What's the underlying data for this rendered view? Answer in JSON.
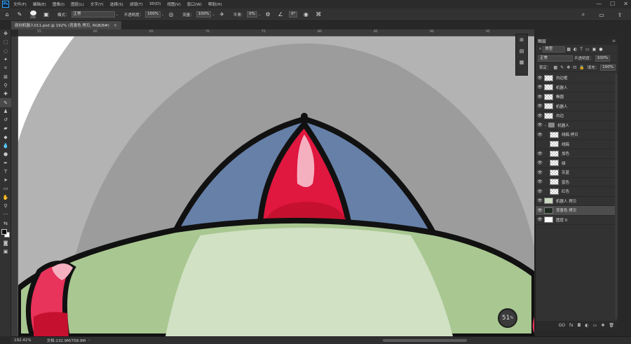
{
  "app": {
    "logo": "Ps",
    "menu": [
      "文件(F)",
      "编辑(E)",
      "图像(I)",
      "图层(L)",
      "文字(Y)",
      "选择(S)",
      "滤镜(T)",
      "3D(D)",
      "视图(V)",
      "窗口(W)",
      "帮助(H)"
    ],
    "window_controls": [
      "—",
      "☐",
      "✕"
    ]
  },
  "options_bar": {
    "brush_size": "256",
    "mode_label": "模式：",
    "mode_value": "正常",
    "opacity_label": "不透明度：",
    "opacity_value": "100%",
    "flow_label": "流量：",
    "flow_value": "100%",
    "smoothing_label": "平滑：",
    "smoothing_value": "0%",
    "angle_value": "0°"
  },
  "document": {
    "tab_title": "原创机器人011.psd @ 192% (背景色 拷贝, RGB/8#)",
    "close": "×"
  },
  "rulers": {
    "top": [
      "55",
      "60",
      "65",
      "70",
      "75",
      "80",
      "85",
      "90",
      "95"
    ]
  },
  "status": {
    "zoom": "192.41%",
    "doc_info": "文档:132.9M/758.9M",
    "arrow": "›"
  },
  "zoom_hud": {
    "value": "51",
    "unit": "%"
  },
  "layers_panel": {
    "title": "图层",
    "close": "≡",
    "filter_kind": "类型",
    "blend_mode": "正常",
    "opacity_label": "不透明度：",
    "opacity_value": "100%",
    "lock_label": "锁定：",
    "fill_label": "填充：",
    "fill_value": "100%",
    "layers": [
      {
        "name": "白边框",
        "visible": true,
        "indent": false
      },
      {
        "name": "机器人",
        "visible": true,
        "indent": false
      },
      {
        "name": "椭圆",
        "visible": true,
        "indent": false
      },
      {
        "name": "机器人",
        "visible": true,
        "indent": false
      },
      {
        "name": "白边",
        "visible": true,
        "indent": false
      },
      {
        "name": "机器人",
        "visible": true,
        "indent": false,
        "group": true
      },
      {
        "name": "线稿 拷贝",
        "visible": true,
        "indent": true
      },
      {
        "name": "线稿",
        "visible": false,
        "indent": true
      },
      {
        "name": "加色",
        "visible": true,
        "indent": true
      },
      {
        "name": "绿",
        "visible": true,
        "indent": true
      },
      {
        "name": "灰蓝",
        "visible": true,
        "indent": true
      },
      {
        "name": "蓝色",
        "visible": true,
        "indent": true
      },
      {
        "name": "红色",
        "visible": true,
        "indent": true
      },
      {
        "name": "机器人 拷贝",
        "visible": true,
        "indent": false
      },
      {
        "name": "背景色 拷贝",
        "visible": true,
        "indent": false,
        "selected": true
      },
      {
        "name": "图层 0",
        "visible": true,
        "indent": false
      }
    ],
    "footer_icons": [
      "GO",
      "fx",
      "◘",
      "◐",
      "▭",
      "✚",
      "🗑"
    ]
  },
  "colors": {
    "canvas_gray": "#9c9c9c",
    "canvas_light": "#b8b8b8",
    "hat_blue": "#6680a8",
    "hat_red": "#e0173f",
    "body_green": "#a9c791",
    "body_light": "#d0e1c4",
    "ruby": "#e8335a"
  }
}
